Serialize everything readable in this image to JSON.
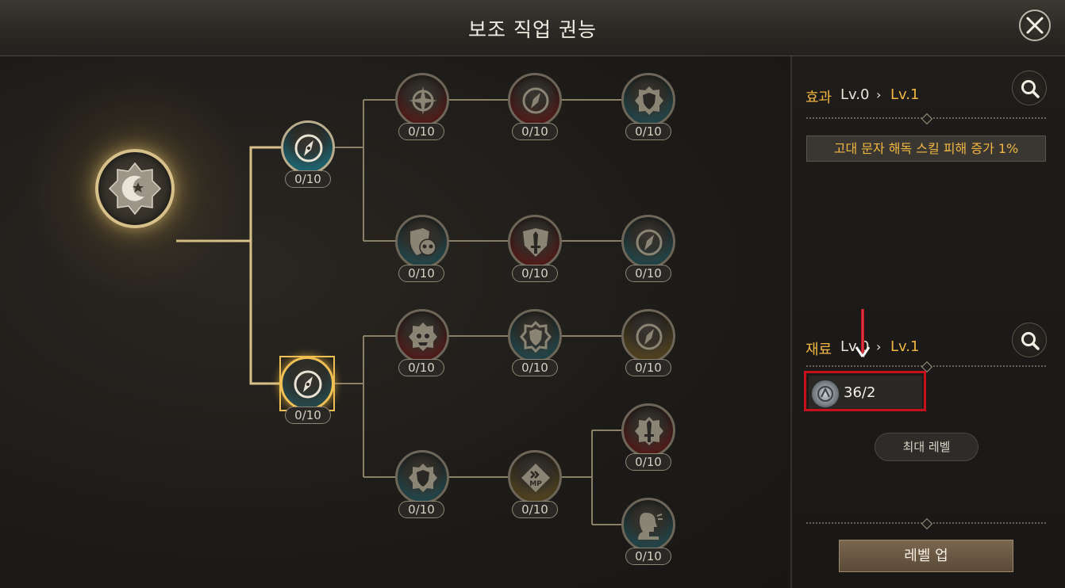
{
  "header": {
    "title": "보조 직업 권능"
  },
  "tree": {
    "root": {
      "icon": "crescent-star-emblem-icon"
    },
    "nodes": [
      {
        "id": "b1",
        "icon": "compass-icon",
        "progress": "0/10"
      },
      {
        "id": "b2",
        "icon": "compass-icon",
        "progress": "0/10"
      },
      {
        "id": "r1c1",
        "icon": "crosshair-star-icon",
        "progress": "0/10"
      },
      {
        "id": "r1c2",
        "icon": "compass-icon",
        "progress": "0/10"
      },
      {
        "id": "r1c3",
        "icon": "shield-badge-icon",
        "progress": "0/10"
      },
      {
        "id": "r2c1",
        "icon": "shield-skull-icon",
        "progress": "0/10"
      },
      {
        "id": "r2c2",
        "icon": "sword-icon",
        "progress": "0/10"
      },
      {
        "id": "r2c3",
        "icon": "compass-icon",
        "progress": "0/10"
      },
      {
        "id": "r3c1",
        "icon": "demon-skull-icon",
        "progress": "0/10"
      },
      {
        "id": "r3c2",
        "icon": "shield-badge-icon",
        "progress": "0/10"
      },
      {
        "id": "r3c3",
        "icon": "compass-icon",
        "progress": "0/10"
      },
      {
        "id": "r4c1",
        "icon": "shield-badge-icon",
        "progress": "0/10"
      },
      {
        "id": "r4c2",
        "icon": "mp-boost-icon",
        "progress": "0/10",
        "label": "MP"
      },
      {
        "id": "r4c3",
        "icon": "sword-icon",
        "progress": "0/10"
      },
      {
        "id": "r5c3",
        "icon": "head-silhouette-icon",
        "progress": "0/10"
      }
    ]
  },
  "panel": {
    "effect": {
      "label": "효과",
      "from": "Lv.0",
      "arrow": "›",
      "to": "Lv.1",
      "description": "고대 문자 해독 스킬 피해 증가 1%"
    },
    "material": {
      "label": "재료",
      "from": "Lv.0",
      "arrow": "›",
      "to": "Lv.1",
      "count": "36/2",
      "icon": "material-coin-icon"
    },
    "max_level_label": "최대 레벨",
    "level_up_label": "레벨 업"
  },
  "colors": {
    "accent_gold": "#f0b640",
    "highlight_red": "#c8101c",
    "selection_gold": "#f0c054"
  }
}
